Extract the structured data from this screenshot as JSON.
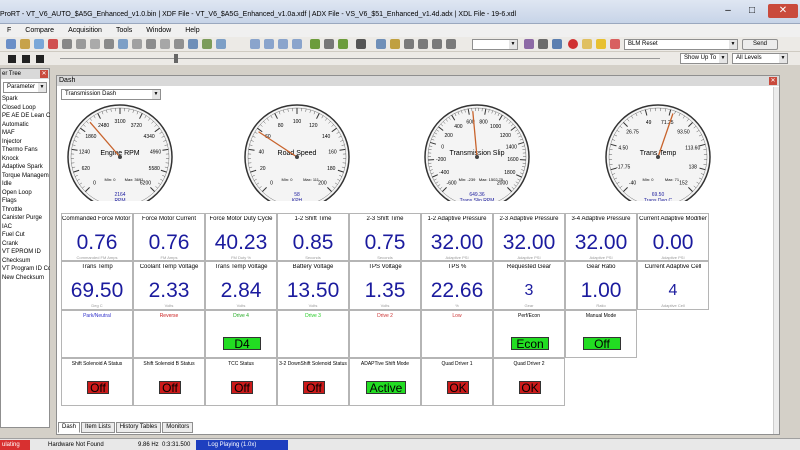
{
  "titlebar": {
    "text": "ProRT - VT_V6_AUTO_$A5G_Enhanced_v1.0.bin | XDF File - VT_V6_$A5G_Enhanced_v1.0a.xdf | ADX File - VS_V6_$51_Enhanced_v1.4d.adx | XDL File - 19-6.xdl"
  },
  "menu": [
    "F",
    "Compare",
    "Acquisition",
    "Tools",
    "Window",
    "Help"
  ],
  "toolbar": {
    "bin_combo": "BLM Reset",
    "send_label": "Send",
    "showupto": "Show Up To",
    "alllevels": "All Levels"
  },
  "param_tree": {
    "title": "er Tree",
    "filter": "Parameter",
    "items": [
      "Spark",
      "Closed Loop",
      "PE AE DE Lean Cr",
      "Automatic",
      "MAF",
      "Injector",
      "Thermo Fans",
      "Knock",
      "Adaptive Spark",
      "Torque Managem",
      "Idle",
      "Open Loop",
      "Flags",
      "Throttle",
      "Canister Purge",
      "IAC",
      "Fuel Cut",
      "Crank",
      "VT EPROM ID",
      "Checksum",
      "VT Program ID Co",
      "New Checksum"
    ]
  },
  "dash": {
    "title": "Dash",
    "selector": "Transmission Dash"
  },
  "gauges": [
    {
      "title": "Engine RPM",
      "unit": "RPM",
      "value": "2164",
      "min": "Min: 0",
      "max": "Max: 3691",
      "ticks": [
        "0",
        "620",
        "1240",
        "1860",
        "2480",
        "3100",
        "3720",
        "4340",
        "4960",
        "5580",
        "6200"
      ]
    },
    {
      "title": "Road Speed",
      "unit": "KPH",
      "value": "58",
      "min": "Min: 0",
      "max": "Max: 111",
      "ticks": [
        "0",
        "20",
        "40",
        "60",
        "80",
        "100",
        "120",
        "140",
        "160",
        "180",
        "200"
      ]
    },
    {
      "title": "Transmission Slip",
      "unit": "Trans Slip RPM",
      "value": "649.36",
      "min": "Min: -239",
      "max": "Max: 1502.75",
      "ticks": [
        "-600",
        "-400",
        "-200",
        "0",
        "200",
        "400",
        "600",
        "800",
        "1000",
        "1200",
        "1400",
        "1600",
        "1800",
        "2000"
      ]
    },
    {
      "title": "Trans Temp",
      "unit": "Trans Deg C",
      "value": "69.50",
      "min": "Min: 0",
      "max": "Max: 71",
      "ticks": [
        "-40",
        "-17.75",
        "4.50",
        "26.75",
        "49",
        "71.25",
        "93.50",
        "113.60",
        "138",
        "152"
      ]
    }
  ],
  "row1": [
    {
      "label": "Commanded Force Motor Curre",
      "value": "0.76",
      "sub": "Commanded FM Amps"
    },
    {
      "label": "Force Motor Current",
      "value": "0.76",
      "sub": "FM Amps"
    },
    {
      "label": "Force Motor Duty Cycle",
      "value": "40.23",
      "sub": "FM Duty %"
    },
    {
      "label": "1-2 Shift Time",
      "value": "0.85",
      "sub": "Seconds"
    },
    {
      "label": "2-3 Shift Time",
      "value": "0.75",
      "sub": "Seconds"
    },
    {
      "label": "1-2 Adaptive Pressure",
      "value": "32.00",
      "sub": "Adaptive PSI"
    },
    {
      "label": "2-3 Adaptive Pressure",
      "value": "32.00",
      "sub": "Adaptive PSI"
    },
    {
      "label": "3-4 Adaptive Pressure",
      "value": "32.00",
      "sub": "Adaptive PSI"
    },
    {
      "label": "Current Adaptive Modifier",
      "value": "0.00",
      "sub": "Adaptive PSI"
    }
  ],
  "row2": [
    {
      "label": "Trans Temp",
      "value": "69.50",
      "sub": "Deg C"
    },
    {
      "label": "Coolant Temp Voltage",
      "value": "2.33",
      "sub": "Volts"
    },
    {
      "label": "Trans Temp Voltage",
      "value": "2.84",
      "sub": "Volts"
    },
    {
      "label": "Battery Voltage",
      "value": "13.50",
      "sub": "Volts"
    },
    {
      "label": "TPS Voltage",
      "value": "1.35",
      "sub": "Volts"
    },
    {
      "label": "TPS %",
      "value": "22.66",
      "sub": "%"
    },
    {
      "label": "Requested Gear",
      "value": "3",
      "sub": "Gear"
    },
    {
      "label": "Gear Ratio",
      "value": "1.00",
      "sub": "Ratio"
    },
    {
      "label": "Current Adaptive Cell",
      "value": "4",
      "sub": "Adaptive Cell"
    }
  ],
  "row3": [
    {
      "label": "Park/Neutral",
      "color": "#3333cc",
      "badge": ""
    },
    {
      "label": "Reverse",
      "color": "#cc2222",
      "badge": ""
    },
    {
      "label": "Drive 4",
      "color": "#22aa22",
      "badge": "D4"
    },
    {
      "label": "Drive 3",
      "color": "#22cc22",
      "badge": ""
    },
    {
      "label": "Drive 2",
      "color": "#cc3333",
      "badge": ""
    },
    {
      "label": "Low",
      "color": "#cc3333",
      "badge": ""
    },
    {
      "label": "Perf/Econ",
      "color": "#000000",
      "badge": "Econ"
    },
    {
      "label": "Manual Mode",
      "color": "#000000",
      "badge": "Off"
    }
  ],
  "row4": [
    {
      "label": "Shift Solenoid A Status",
      "badge": "Off",
      "state": "red"
    },
    {
      "label": "Shift Solenoid B Status",
      "badge": "Off",
      "state": "red"
    },
    {
      "label": "TCC Status",
      "badge": "Off",
      "state": "red"
    },
    {
      "label": "3-2 DownShift Solenoid Status",
      "badge": "Off",
      "state": "red"
    },
    {
      "label": "ADAPTive Shift Mode",
      "badge": "Active",
      "state": "green"
    },
    {
      "label": "Quad Driver 1",
      "badge": "OK",
      "state": "red"
    },
    {
      "label": "Quad Driver 2",
      "badge": "OK",
      "state": "red"
    }
  ],
  "tabs": [
    "Dash",
    "Item Lists",
    "History Tables",
    "Monitors"
  ],
  "status": {
    "left": "ulating",
    "hardware": "Hardware Not Found",
    "hz": "9.86 Hz",
    "time": "0:3:31.500",
    "log": "Log Playing (1.0x)"
  }
}
